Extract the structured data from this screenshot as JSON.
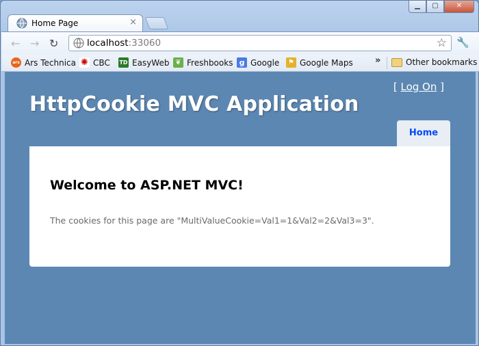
{
  "browser": {
    "tab_title": "Home Page",
    "tab_close": "×",
    "address_host": "localhost",
    "address_port": ":33060",
    "icons": [
      "globe-icon",
      "back-icon",
      "forward-icon",
      "reload-icon",
      "star-icon",
      "wrench-icon",
      "folder-icon"
    ],
    "bookmarks": [
      {
        "label": "Ars Technica",
        "icon": "ars",
        "color": "#e8641b",
        "text": "ars"
      },
      {
        "label": "CBC",
        "icon": "cbc",
        "color": "#cc0000",
        "text": "✺"
      },
      {
        "label": "EasyWeb",
        "icon": "td",
        "color": "#2a7a2a",
        "text": "TD"
      },
      {
        "label": "Freshbooks",
        "icon": "freshbooks",
        "color": "#6ab04c",
        "text": "❦"
      },
      {
        "label": "Google",
        "icon": "google",
        "color": "#4a7be3",
        "text": "g"
      },
      {
        "label": "Google Maps",
        "icon": "google-maps",
        "color": "#e4b22a",
        "text": "⚑"
      }
    ],
    "more_chevron": "»",
    "other_bookmarks": "Other bookmarks"
  },
  "page": {
    "login_open": "[",
    "login_link": "Log On",
    "login_close": "]",
    "title": "HttpCookie MVC Application",
    "menu": [
      {
        "label": "Home"
      }
    ],
    "heading": "Welcome to ASP.NET MVC!",
    "message": "The cookies for this page are \"MultiValueCookie=Val1=1&Val2=2&Val3=3\"."
  },
  "colors": {
    "page_bg": "#5c87b2",
    "menu_link": "#034af3"
  }
}
